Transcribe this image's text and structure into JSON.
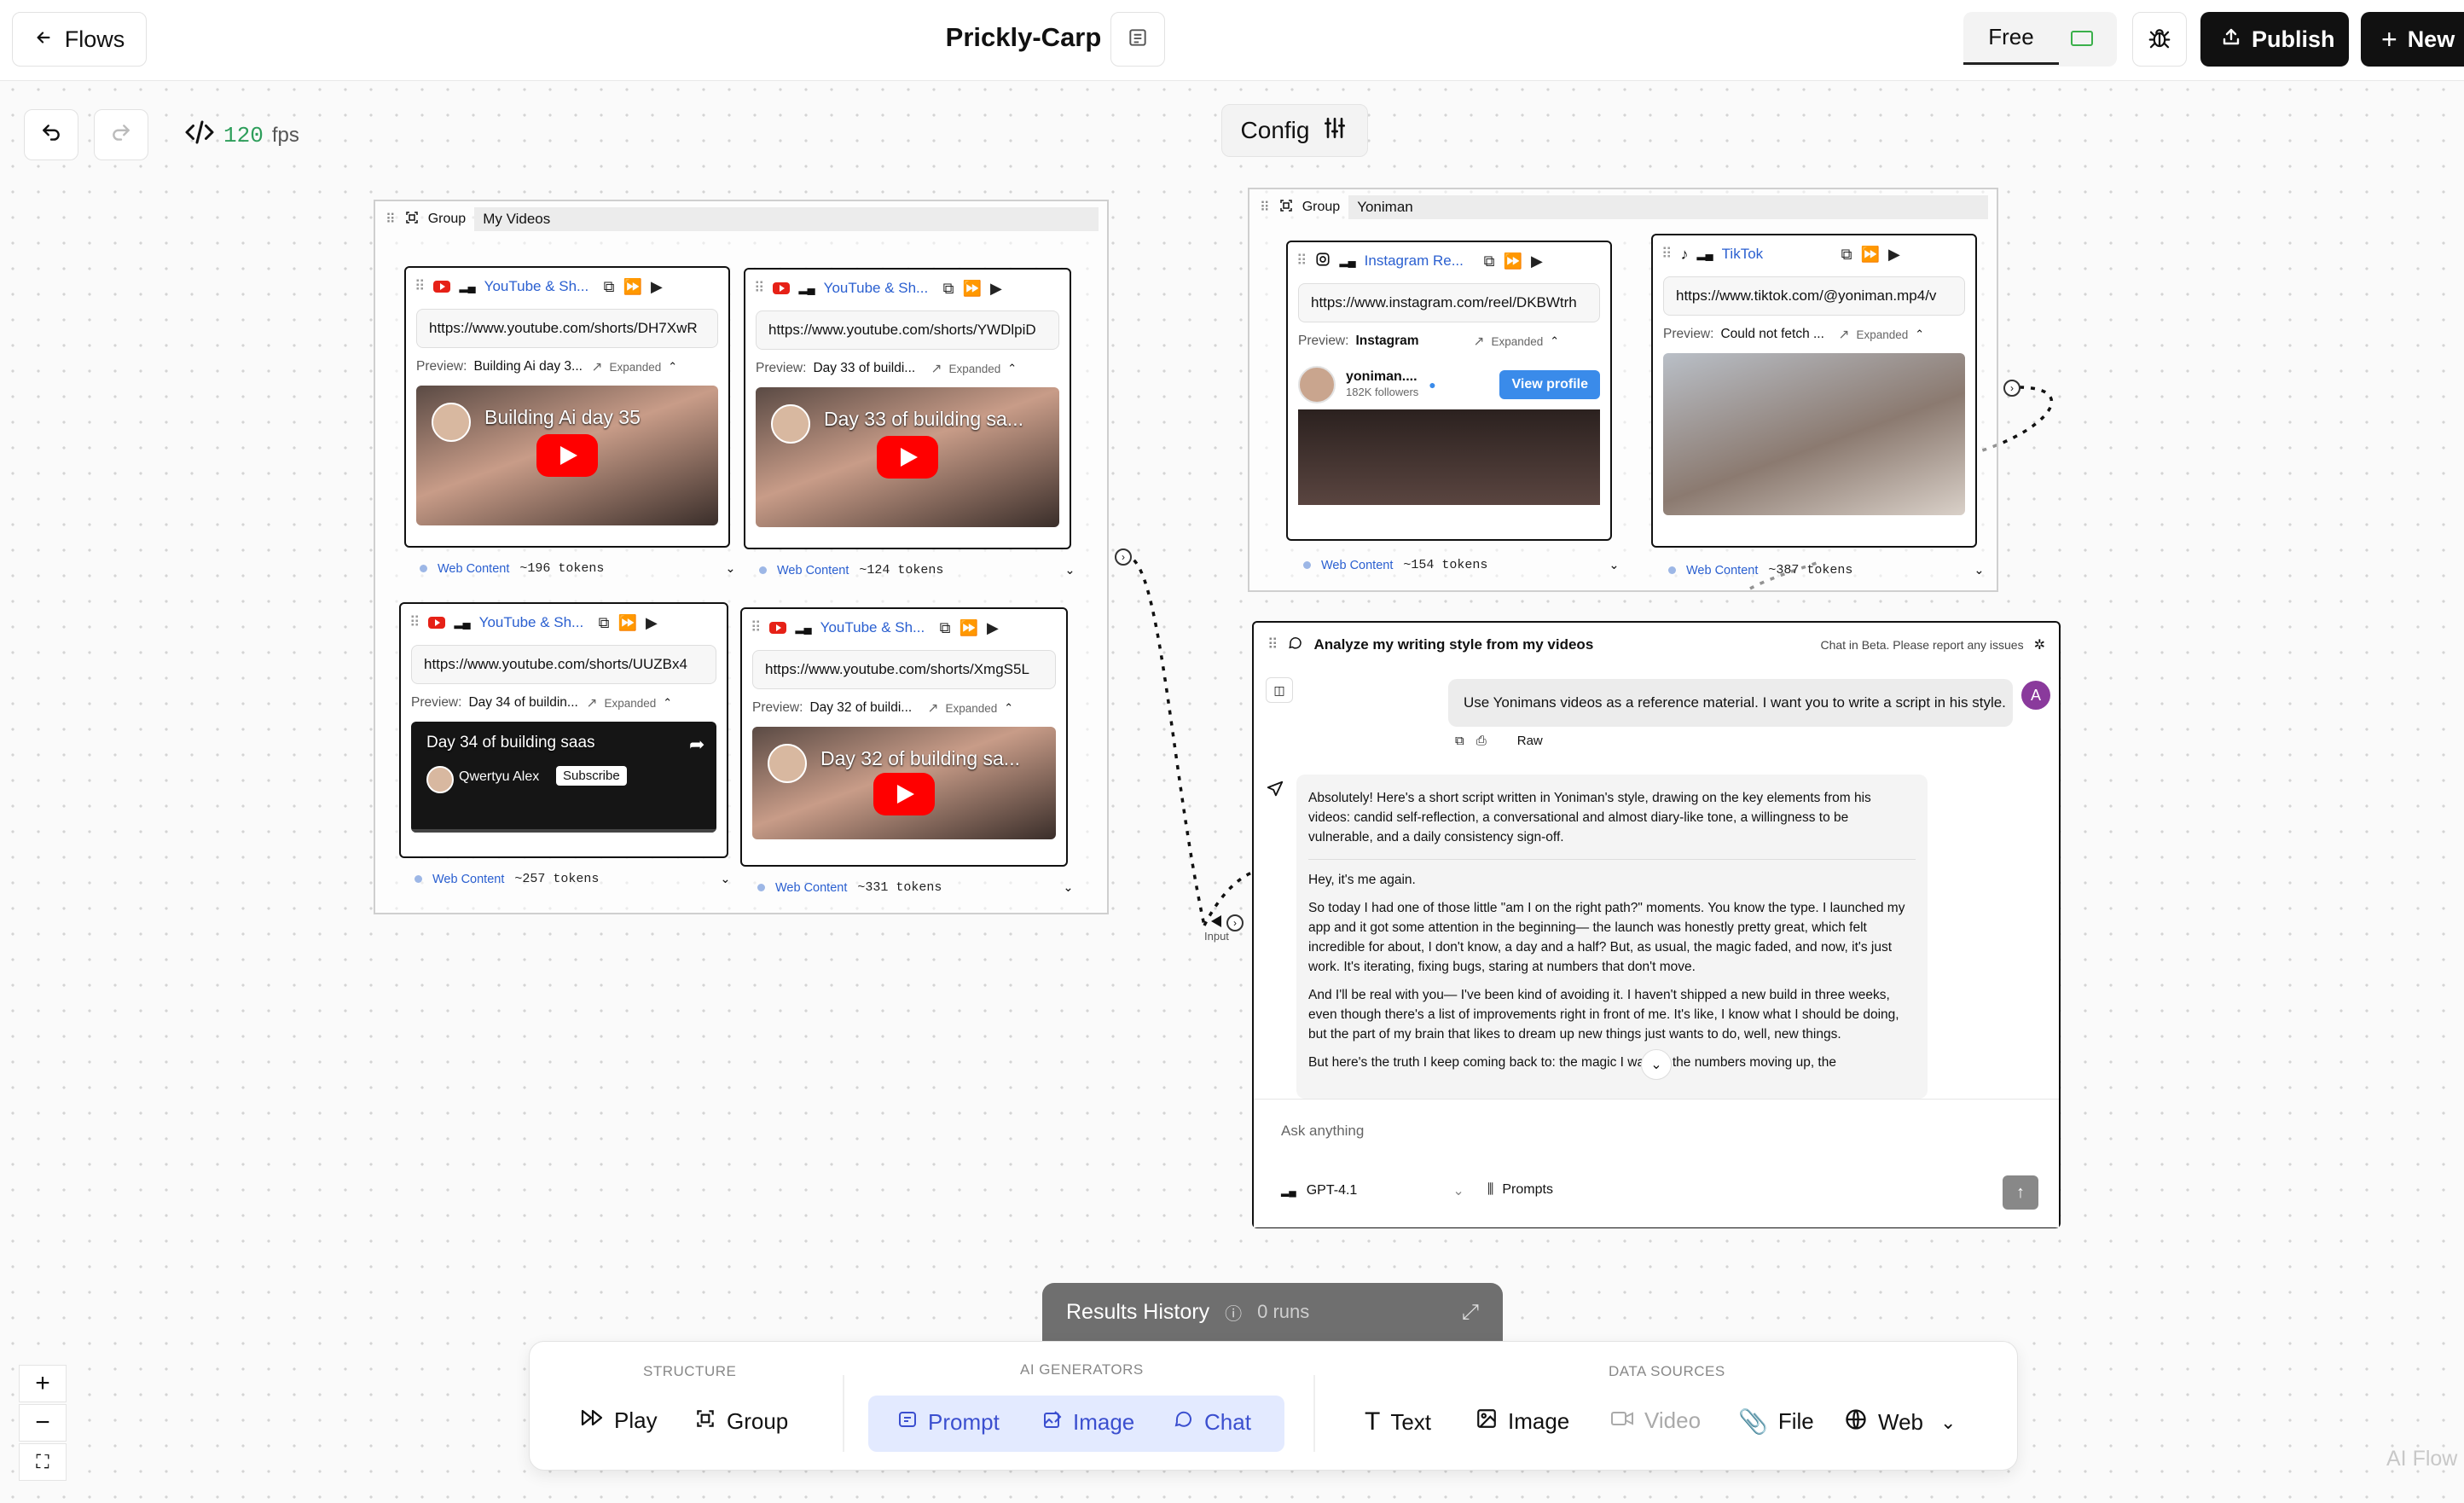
{
  "topbar": {
    "flows_label": "Flows",
    "title": "Prickly-Carp",
    "plan_label": "Free",
    "publish_label": "Publish",
    "new_label": "New"
  },
  "canvas": {
    "fps_value": "120",
    "fps_unit": "fps",
    "config_label": "Config"
  },
  "groups": [
    {
      "tag": "Group",
      "name": "My Videos"
    },
    {
      "tag": "Group",
      "name": "Yoniman"
    }
  ],
  "video_cards": [
    {
      "name": "YouTube & Sh...",
      "url": "https://www.youtube.com/shorts/DH7XwR",
      "preview_label": "Preview:",
      "preview": "Building Ai day 3...",
      "expanded": "Expanded",
      "thumb_title": "Building Ai day 35",
      "footer_label": "Web Content",
      "tokens": "~196 tokens"
    },
    {
      "name": "YouTube & Sh...",
      "url": "https://www.youtube.com/shorts/YWDlpiD",
      "preview_label": "Preview:",
      "preview": "Day 33 of buildi...",
      "expanded": "Expanded",
      "thumb_title": "Day 33 of building sa...",
      "footer_label": "Web Content",
      "tokens": "~124 tokens"
    },
    {
      "name": "YouTube & Sh...",
      "url": "https://www.youtube.com/shorts/UUZBx4",
      "preview_label": "Preview:",
      "preview": "Day 34 of buildin...",
      "expanded": "Expanded",
      "thumb_title": "Day 34 of building saas",
      "thumb_channel": "Qwertyu Alex",
      "thumb_subscribe": "Subscribe",
      "footer_label": "Web Content",
      "tokens": "~257 tokens"
    },
    {
      "name": "YouTube & Sh...",
      "url": "https://www.youtube.com/shorts/XmgS5L",
      "preview_label": "Preview:",
      "preview": "Day 32 of buildi...",
      "expanded": "Expanded",
      "thumb_title": "Day 32 of building sa...",
      "footer_label": "Web Content",
      "tokens": "~331 tokens"
    },
    {
      "name": "Instagram Re...",
      "url": "https://www.instagram.com/reel/DKBWtrh",
      "preview_label": "Preview:",
      "preview": "Instagram",
      "expanded": "Expanded",
      "profile_name": "yoniman....",
      "profile_followers": "182K followers",
      "profile_button": "View profile",
      "footer_label": "Web Content",
      "tokens": "~154 tokens"
    },
    {
      "name": "TikTok",
      "url": "https://www.tiktok.com/@yoniman.mp4/v",
      "preview_label": "Preview:",
      "preview": "Could not fetch ...",
      "expanded": "Expanded",
      "footer_label": "Web Content",
      "tokens": "~387 tokens"
    }
  ],
  "input_label": "Input",
  "chat": {
    "title": "Analyze my writing style from my videos",
    "beta_note": "Chat in Beta. Please report any issues",
    "user_avatar": "A",
    "user_message": "Use Yonimans videos as a reference material. I want you to write a script in his style.",
    "raw_label": "Raw",
    "response": [
      "Absolutely! Here's a short script written in Yoniman's style, drawing on the key elements from his videos: candid self-reflection, a conversational and almost diary-like tone, a willingness to be vulnerable, and a daily consistency sign-off.",
      "Hey, it's me again.",
      "So today I had one of those little \"am I on the right path?\" moments. You know the type. I launched my app and it got some attention in the beginning— the launch was honestly pretty great, which felt incredible for about, I don't know, a day and a half? But, as usual, the magic faded, and now, it's just work. It's iterating, fixing bugs, staring at numbers that don't move.",
      "And I'll be real with you— I've been kind of avoiding it. I haven't shipped a new build in three weeks, even though there's a list of improvements right in front of me. It's like, I know what I should be doing, but the part of my brain that likes to dream up new things just wants to do, well, new things.",
      "But here's the truth I keep coming back to: the magic I want— the numbers moving up, the"
    ],
    "input_placeholder": "Ask anything",
    "model": "GPT-4.1",
    "prompts_label": "Prompts"
  },
  "results_history": {
    "label": "Results History",
    "runs": "0 runs"
  },
  "toolbar": {
    "structure_label": "STRUCTURE",
    "ai_label": "AI GENERATORS",
    "data_label": "DATA SOURCES",
    "play": "Play",
    "group": "Group",
    "prompt": "Prompt",
    "image_ai": "Image",
    "chat": "Chat",
    "text": "Text",
    "image": "Image",
    "video": "Video",
    "file": "File",
    "web": "Web"
  },
  "watermark": "AI Flow"
}
